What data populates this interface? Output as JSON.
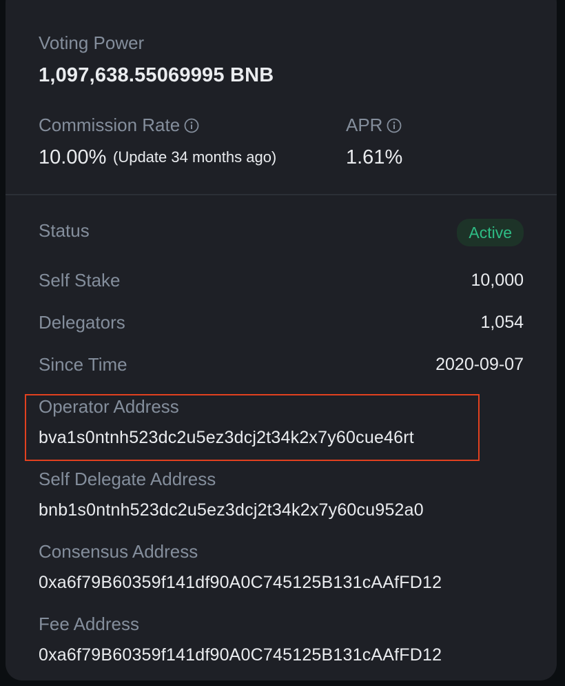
{
  "voting_power": {
    "label": "Voting Power",
    "value": "1,097,638.55069995 BNB"
  },
  "commission": {
    "label": "Commission Rate",
    "value": "10.00%",
    "note": "(Update 34 months ago)"
  },
  "apr": {
    "label": "APR",
    "value": "1.61%"
  },
  "status": {
    "label": "Status",
    "value": "Active",
    "color": "#2ebd85"
  },
  "self_stake": {
    "label": "Self Stake",
    "value": "10,000"
  },
  "delegators": {
    "label": "Delegators",
    "value": "1,054"
  },
  "since_time": {
    "label": "Since Time",
    "value": "2020-09-07"
  },
  "operator_address": {
    "label": "Operator Address",
    "value": "bva1s0ntnh523dc2u5ez3dcj2t34k2x7y60cue46rt",
    "highlight_color": "#e2411f"
  },
  "self_delegate_address": {
    "label": "Self Delegate Address",
    "value": "bnb1s0ntnh523dc2u5ez3dcj2t34k2x7y60cu952a0"
  },
  "consensus_address": {
    "label": "Consensus Address",
    "value": "0xa6f79B60359f141df90A0C745125B131cAAfFD12"
  },
  "fee_address": {
    "label": "Fee Address",
    "value": "0xa6f79B60359f141df90A0C745125B131cAAfFD12"
  },
  "icons": {
    "info": "info-circle-icon"
  }
}
